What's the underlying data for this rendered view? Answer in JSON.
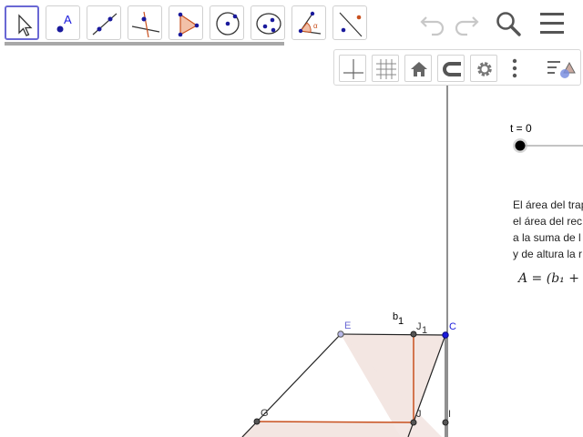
{
  "toolbar": {
    "tools": [
      {
        "name": "move-tool-icon",
        "selected": true
      },
      {
        "name": "point-tool-icon",
        "label": "A"
      },
      {
        "name": "line-tool-icon"
      },
      {
        "name": "perpendicular-line-tool-icon"
      },
      {
        "name": "polygon-tool-icon"
      },
      {
        "name": "circle-tool-icon"
      },
      {
        "name": "ellipse-tool-icon"
      },
      {
        "name": "angle-tool-icon"
      },
      {
        "name": "reflect-tool-icon"
      }
    ],
    "undo_icon": "undo-icon",
    "redo_icon": "redo-icon",
    "search_icon": "search-icon",
    "menu_icon": "hamburger-menu-icon"
  },
  "stylebar": {
    "buttons": [
      "axes-icon",
      "grid-icon",
      "home-icon",
      "point-capturing-icon",
      "gear-icon",
      "more-vertical-icon",
      "view-toggle-icon"
    ]
  },
  "slider": {
    "label": "t = 0",
    "value": 0
  },
  "description": {
    "lines": [
      "El área del trap",
      "el área del rec",
      "a la suma de l",
      "y de altura la r"
    ]
  },
  "formula": "A = (b₁ + (",
  "points": {
    "E": "E",
    "J1": "J",
    "J1_sub": "1",
    "C": "C",
    "G": "G",
    "J": "J",
    "I": "I",
    "b1": "b",
    "b1_sub": "1"
  },
  "colors": {
    "accent": "#6a68d4",
    "trapezoid_fill": "#f3e6e2",
    "orange_segment": "#c8501e",
    "point_blue": "#1a1adc"
  }
}
